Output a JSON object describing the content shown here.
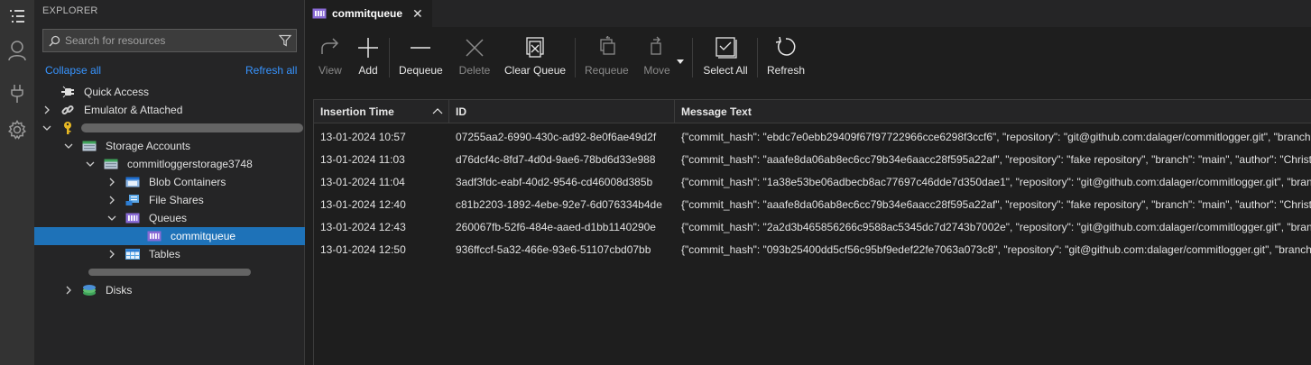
{
  "explorer": {
    "title": "EXPLORER",
    "search_placeholder": "Search for resources",
    "collapse_all": "Collapse all",
    "refresh_all": "Refresh all",
    "tree": [
      {
        "label": "Quick Access"
      },
      {
        "label": "Emulator & Attached"
      },
      {
        "label": ""
      },
      {
        "label": "Storage Accounts"
      },
      {
        "label": "commitloggerstorage3748"
      },
      {
        "label": "Blob Containers"
      },
      {
        "label": "File Shares"
      },
      {
        "label": "Queues"
      },
      {
        "label": "commitqueue"
      },
      {
        "label": "Tables"
      },
      {
        "label": ""
      },
      {
        "label": "Disks"
      }
    ]
  },
  "tab": {
    "label": "commitqueue",
    "close": "✕"
  },
  "toolbar": {
    "view": "View",
    "add": "Add",
    "dequeue": "Dequeue",
    "delete": "Delete",
    "clear_queue": "Clear Queue",
    "requeue": "Requeue",
    "move": "Move",
    "select_all": "Select All",
    "refresh": "Refresh"
  },
  "table": {
    "columns": [
      "Insertion Time",
      "ID",
      "Message Text"
    ],
    "rows": [
      {
        "time": "13-01-2024 10:57",
        "id": "07255aa2-6990-430c-ad92-8e0f6ae49d2f",
        "text": "{\"commit_hash\": \"ebdc7e0ebb29409f67f97722966cce6298f3ccf6\", \"repository\": \"git@github.com:dalager/commitlogger.git\", \"branch"
      },
      {
        "time": "13-01-2024 11:03",
        "id": "d76dcf4c-8fd7-4d0d-9ae6-78bd6d33e988",
        "text": "{\"commit_hash\": \"aaafe8da06ab8ec6cc79b34e6aacc28f595a22af\", \"repository\": \"fake repository\", \"branch\": \"main\", \"author\": \"Christia"
      },
      {
        "time": "13-01-2024 11:04",
        "id": "3adf3fdc-eabf-40d2-9546-cd46008d385b",
        "text": "{\"commit_hash\": \"1a38e53be06adbecb8ac77697c46dde7d350dae1\", \"repository\": \"git@github.com:dalager/commitlogger.git\", \"bran"
      },
      {
        "time": "13-01-2024 12:40",
        "id": "c81b2203-1892-4ebe-92e7-6d076334b4de",
        "text": "{\"commit_hash\": \"aaafe8da06ab8ec6cc79b34e6aacc28f595a22af\", \"repository\": \"fake repository\", \"branch\": \"main\", \"author\": \"Christia"
      },
      {
        "time": "13-01-2024 12:43",
        "id": "260067fb-52f6-484e-aaed-d1bb1140290e",
        "text": "{\"commit_hash\": \"2a2d3b465856266c9588ac5345dc7d2743b7002e\", \"repository\": \"git@github.com:dalager/commitlogger.git\", \"bran"
      },
      {
        "time": "13-01-2024 12:50",
        "id": "936ffccf-5a32-466e-93e6-51107cbd07bb",
        "text": "{\"commit_hash\": \"093b25400dd5cf56c95bf9edef22fe7063a073c8\", \"repository\": \"git@github.com:dalager/commitlogger.git\", \"branch"
      }
    ]
  },
  "colors": {
    "selection": "#1e72b8",
    "link": "#3794ff",
    "queue_icon": "#8a6bd6"
  }
}
